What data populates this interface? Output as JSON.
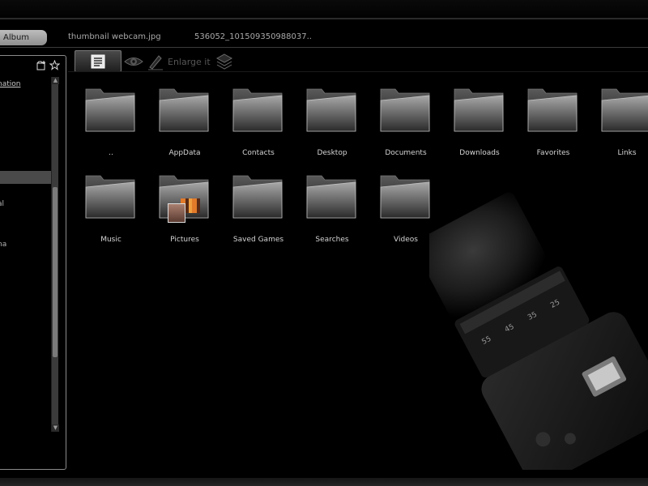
{
  "tabs": {
    "active": "Album",
    "items": [
      "thumbnail webcam.jpg",
      "536052_101509350988037.."
    ]
  },
  "side_panel": {
    "items": [
      "nation",
      "",
      "al",
      "na"
    ]
  },
  "toolbar": {
    "enlarge_label": "Enlarge it"
  },
  "folders": [
    {
      "label": "..",
      "icon": "folder-icon"
    },
    {
      "label": "AppData",
      "icon": "folder-icon"
    },
    {
      "label": "Contacts",
      "icon": "folder-icon"
    },
    {
      "label": "Desktop",
      "icon": "folder-icon"
    },
    {
      "label": "Documents",
      "icon": "folder-icon"
    },
    {
      "label": "Downloads",
      "icon": "folder-icon"
    },
    {
      "label": "Favorites",
      "icon": "folder-icon"
    },
    {
      "label": "Links",
      "icon": "folder-icon"
    },
    {
      "label": "Music",
      "icon": "folder-icon"
    },
    {
      "label": "Pictures",
      "icon": "folder-with-thumbnails-icon"
    },
    {
      "label": "Saved Games",
      "icon": "folder-icon"
    },
    {
      "label": "Searches",
      "icon": "folder-icon"
    },
    {
      "label": "Videos",
      "icon": "folder-icon"
    }
  ],
  "lens_marks": [
    "55",
    "45",
    "35",
    "25"
  ],
  "colors": {
    "background": "#000000",
    "active_tab": "#a8a8a8",
    "folder": "#8a8a8a",
    "text": "#d4d4d4"
  }
}
